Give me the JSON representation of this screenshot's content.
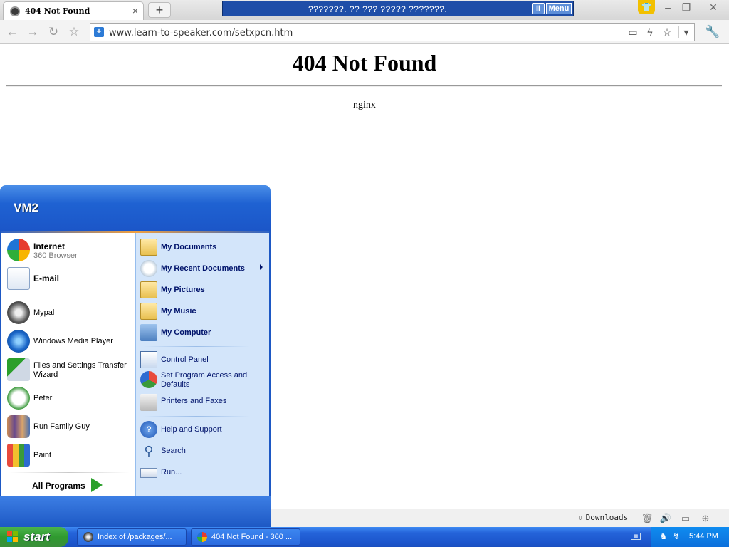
{
  "browser": {
    "tab_title": "404 Not Found",
    "tab_close": "×",
    "new_tab": "+",
    "ticker_text": "???????. ?? ??? ????? ???????.",
    "ticker_pause": "II",
    "ticker_menu": "Menu",
    "url": "www.learn-to-speaker.com/setxpcn.htm",
    "nav_icons": [
      "back-icon",
      "forward-icon",
      "reload-icon",
      "favorite-star-icon"
    ],
    "downloads_label": "Downloads"
  },
  "page": {
    "heading": "404 Not Found",
    "server": "nginx"
  },
  "start_menu": {
    "user": "VM2",
    "pinned": [
      {
        "name": "Internet",
        "sub": "360 Browser",
        "icon": "360-browser-icon"
      },
      {
        "name": "E-mail",
        "icon": "email-icon"
      }
    ],
    "recent": [
      {
        "name": "Mypal",
        "icon": "mypal-raccoon-icon"
      },
      {
        "name": "Windows Media Player",
        "icon": "media-player-icon"
      },
      {
        "name": "Files and Settings Transfer Wizard",
        "icon": "transfer-wizard-icon"
      },
      {
        "name": "Peter",
        "icon": "peter-icon"
      },
      {
        "name": "Run Family Guy",
        "icon": "family-guy-icon"
      },
      {
        "name": "Paint",
        "icon": "paint-icon"
      }
    ],
    "all_programs": "All Programs",
    "places": [
      {
        "name": "My Documents"
      },
      {
        "name": "My Recent Documents"
      },
      {
        "name": "My Pictures"
      },
      {
        "name": "My Music"
      },
      {
        "name": "My Computer"
      }
    ],
    "system": [
      {
        "name": "Control Panel"
      },
      {
        "name": "Set Program Access and Defaults"
      },
      {
        "name": "Printers and Faxes"
      }
    ],
    "help": [
      {
        "name": "Help and Support"
      },
      {
        "name": "Search"
      },
      {
        "name": "Run..."
      }
    ]
  },
  "taskbar": {
    "start": "start",
    "buttons": [
      {
        "label": "Index of /packages/..."
      },
      {
        "label": "404 Not Found - 360 ..."
      }
    ],
    "clock": "5:44 PM",
    "colors": {
      "taskbar": "#2463d9",
      "start": "#2f9a2f",
      "tray": "#0f8cf0"
    }
  }
}
